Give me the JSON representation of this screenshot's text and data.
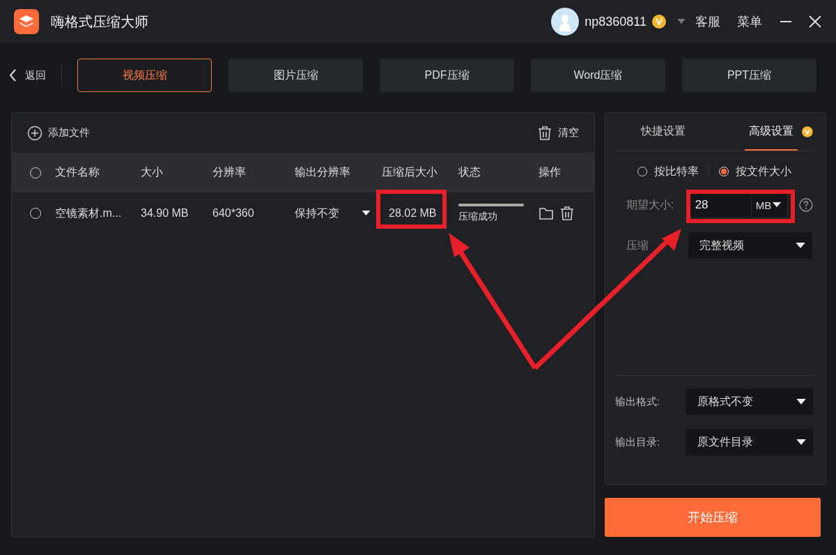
{
  "app": {
    "title": "嗨格式压缩大师"
  },
  "user": {
    "name": "np8360811"
  },
  "header_links": [
    "客服",
    "菜单"
  ],
  "back": "返回",
  "tabs": [
    {
      "label": "视频压缩",
      "selected": true
    },
    {
      "label": "图片压缩",
      "selected": false
    },
    {
      "label": "PDF压缩",
      "selected": false
    },
    {
      "label": "Word压缩",
      "selected": false
    },
    {
      "label": "PPT压缩",
      "selected": false
    }
  ],
  "file_toolbar": {
    "add": "添加文件",
    "clear": "清空"
  },
  "table": {
    "all_selected": false,
    "columns": [
      "文件名称",
      "大小",
      "分辨率",
      "输出分辨率",
      "压缩后大小",
      "状态",
      "操作"
    ],
    "rows": [
      {
        "selected": false,
        "name": "空镜素材.m...",
        "size": "34.90 MB",
        "resolution": "640*360",
        "output_resolution": "保持不变",
        "compressed_size": "28.02 MB",
        "status": {
          "text": "压缩成功",
          "level": 1
        }
      }
    ]
  },
  "settings": {
    "tabs": [
      {
        "label": "快捷设置",
        "selected": false
      },
      {
        "label": "高级设置",
        "selected": true
      }
    ],
    "modes": [
      {
        "label": "按比特率",
        "selected": false
      },
      {
        "label": "按文件大小",
        "selected": true
      }
    ],
    "target_size": {
      "label": "期望大小:",
      "value": "28",
      "unit": "MB"
    },
    "range": {
      "label": "压缩",
      "value": "完整视频"
    },
    "outputs": [
      {
        "label": "输出格式:",
        "value": "原格式不变"
      },
      {
        "label": "输出目录:",
        "value": "原文件目录"
      }
    ]
  },
  "start_button": "开始压缩"
}
